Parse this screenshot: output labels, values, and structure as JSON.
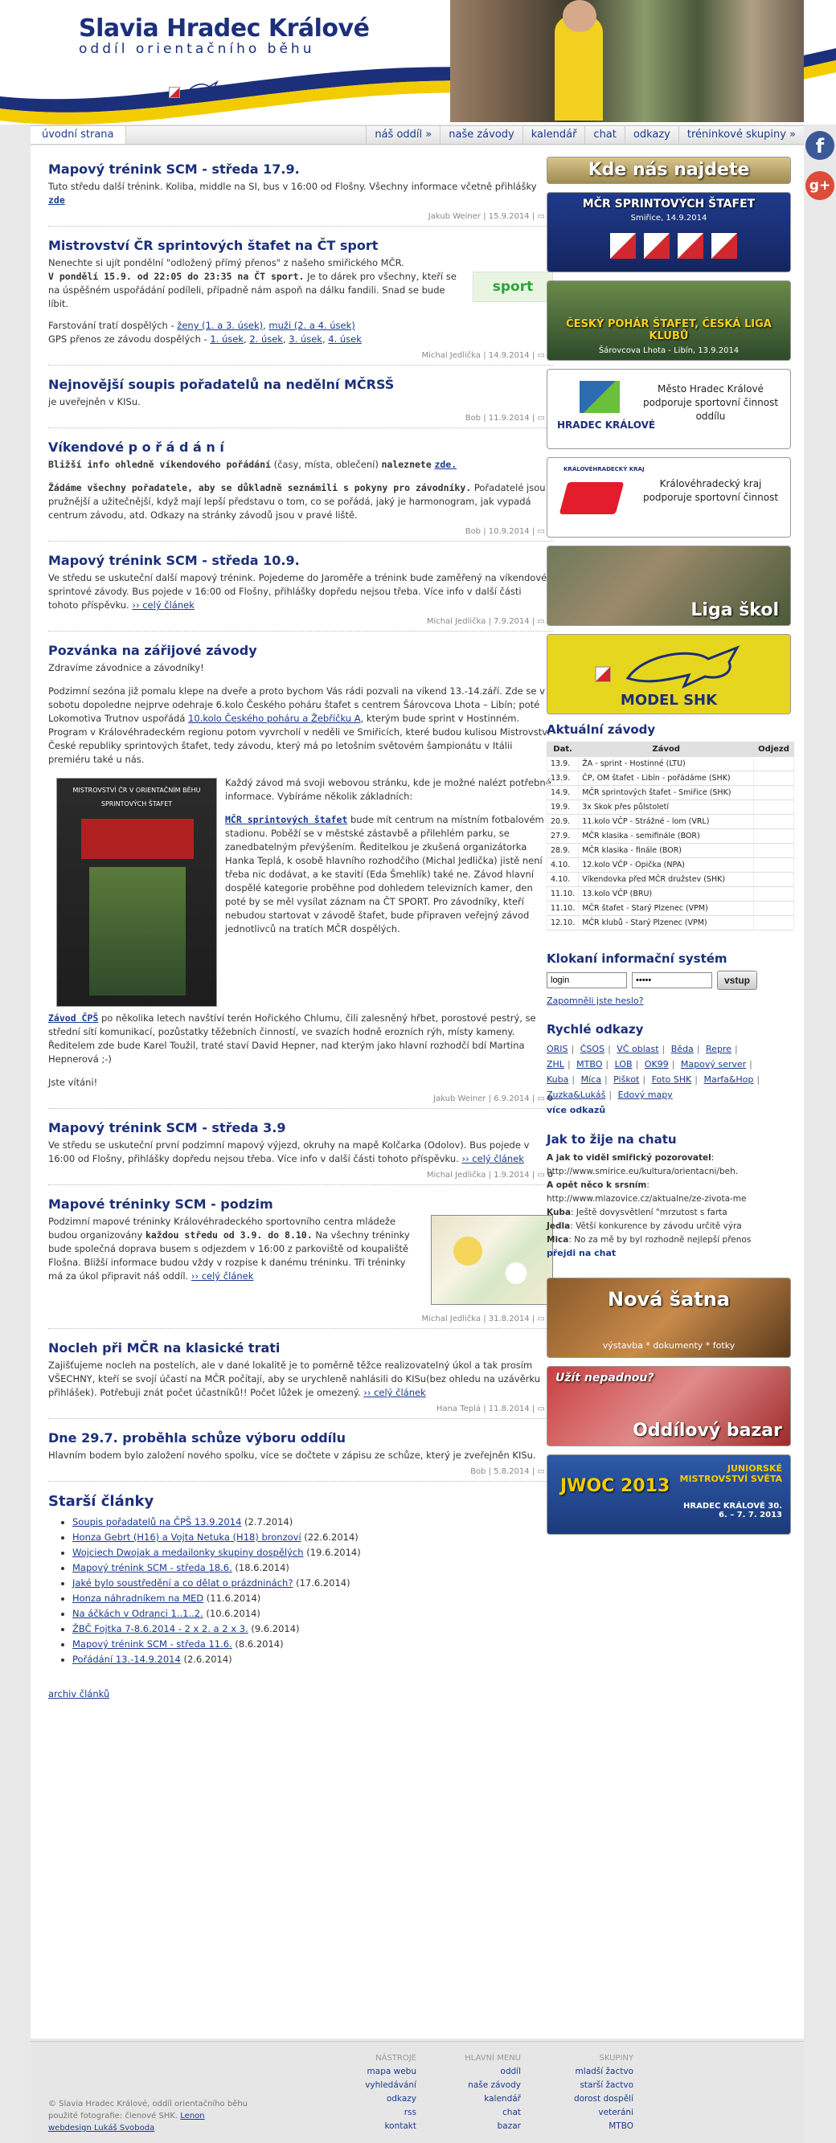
{
  "header": {
    "title": "Slavia Hradec Králové",
    "subtitle": "oddíl orientačního běhu"
  },
  "nav": {
    "home": "úvodní strana",
    "items": [
      "náš oddíl »",
      "naše závody",
      "kalendář",
      "chat",
      "odkazy",
      "tréninkové skupiny »"
    ]
  },
  "social": {
    "facebook": "f",
    "google": "g+"
  },
  "articles": [
    {
      "title": "Mapový trénink SCM - středa 17.9.",
      "body": "Tuto středu další trénink. Koliba, middle na SI, bus v 16:00 od Flošny. Všechny informace včetně přihlášky",
      "link": "zde",
      "author": "Jakub Weiner | 15.9.2014 |",
      "comments": "0"
    },
    {
      "title": "Mistrovství ČR sprintových štafet na ČT sport",
      "body1": "Nenechte si ujít pondělní \"odložený přímý přenos\" z našeho smiřického MČR.",
      "bold1": "V pondělí 15.9. od 22:05 do 23:35 na ČT sport.",
      "body2": "Je to dárek pro všechny, kteří se na úspěšném uspořádání podíleli, případně nám aspoň na dálku fandili. Snad se bude líbit.",
      "body3": "Farstování tratí dospělých -",
      "links3": [
        "ženy (1. a 3. úsek)",
        "muži (2. a 4. úsek)"
      ],
      "body4": "GPS přenos ze závodu dospělých -",
      "links4": [
        "1. úsek",
        "2. úsek",
        "3. úsek",
        "4. úsek"
      ],
      "logo": "sport",
      "author": "Michal Jedlička | 14.9.2014 |",
      "comments": "0"
    },
    {
      "title": "Nejnovější soupis pořadatelů na nedělní MČRSŠ",
      "body": "je uveřejněn v KISu.",
      "author": "Bob | 11.9.2014 |",
      "comments": "0"
    },
    {
      "title": "Víkendové p o ř á d á n í",
      "line1a": "Bližší info ohledně víkendového pořádání",
      "line1b": "(časy, místa, oblečení)",
      "line1c": "naleznete",
      "line1link": "zde.",
      "line2a": "Žádáme všechny pořadatele, aby se důkladně seznámili s pokyny pro závodníky.",
      "line2b": "Pořadatelé jsou pružnější a užitečnější, když mají lepší představu o tom, co se pořádá, jaký je harmonogram, jak vypadá centrum závodu, atd. Odkazy na stránky závodů jsou v pravé liště.",
      "author": "Bob | 10.9.2014 |",
      "comments": "4"
    },
    {
      "title": "Mapový trénink SCM - středa 10.9.",
      "body": "Ve středu se uskuteční další mapový trénink. Pojedeme do Jaroměře a trénink bude zaměřený na víkendové sprintové závody. Bus pojede v 16:00 od Flošny, přihlášky dopředu nejsou třeba. Více info v další části tohoto příspěvku.",
      "link": "›› celý článek",
      "author": "Michal Jedlička | 7.9.2014 |",
      "comments": "0"
    },
    {
      "title": "Pozvánka na zářijové závody",
      "p1": "Zdravíme závodnice a závodníky!",
      "p2": "Podzimní sezóna již pomalu klepe na dveře a proto bychom Vás rádi pozvali na víkend 13.-14.září. Zde se v sobotu dopoledne nejprve odehraje 6.kolo Českého poháru štafet s centrem Šárovcova Lhota – Libín; poté Lokomotiva Trutnov uspořádá",
      "p2link": "10.kolo Českého poháru a Žebříčku A",
      "p2b": ", kterým bude sprint v Hostinném. Program v Královéhradeckém regionu potom vyvrcholí v neděli ve Smiřicích, které budou kulisou Mistrovství České republiky sprintových štafet, tedy závodu, který má po letošním světovém šampionátu v Itálii premiéru také u nás.",
      "p3": "Každý závod má svoji webovou stránku, kde je možné nalézt potřebné informace. Vybíráme několik základních:",
      "p4link": "MČR sprintových štafet",
      "p4": "bude mít centrum na místním fotbalovém stadionu. Poběží se v městské zástavbě a přilehlém parku, se zanedbatelným převýšením. Ředitelkou je zkušená organizátorka Hanka Teplá, k osobě hlavního rozhodčího (Michal Jedlička) jistě není třeba nic dodávat, a ke stavití (Eda Šmehlík) také ne. Závod hlavní dospělé kategorie proběhne pod dohledem televizních kamer, den poté by se měl vysílat záznam na ČT SPORT. Pro závodníky, kteří nebudou startovat v závodě štafet, bude připraven veřejný závod jednotlivců na tratích MČR dospělých.",
      "p5link": "Závod ČPŠ",
      "p5": "po několika letech navštíví terén Hořického Chlumu, čili zalesněný hřbet, porostové pestrý, se střední sítí komunikací, pozůstatky těžebních činností, ve svazích hodně erozních rýh, místy kameny. Ředitelem zde bude Karel Toužil, traté staví David Hepner, nad kterým jako hlavní rozhodčí bdí Martina Hepnerová ;-)",
      "p6": "Jste vítáni!",
      "poster": "MISTROVSTVÍ ČR V ORIENTAČNÍM BĚHU SPRINTOVÝCH ŠTAFET",
      "author": "Jakub Weiner | 6.9.2014 |",
      "comments": "0"
    },
    {
      "title": "Mapový trénink SCM - středa 3.9",
      "body": "Ve středu se uskuteční první podzimní mapový výjezd, okruhy na mapě Kolčarka (Odolov). Bus pojede v 16:00 od Flošny, přihlášky dopředu nejsou třeba. Více info v další části tohoto příspěvku.",
      "link": "›› celý článek",
      "author": "Michal Jedlička | 1.9.2014 |",
      "comments": "0"
    },
    {
      "title": "Mapové tréninky SCM - podzim",
      "body1": "Podzimní mapové tréninky Královéhradeckého sportovního centra mládeže budou organizovány",
      "bold": "každou středu od 3.9. do 8.10.",
      "body2": "Na všechny tréninky bude společná doprava busem s odjezdem v 16:00 z parkoviště od koupaliště Flošna. Bližší informace budou vždy v rozpise k danému tréninku. Tři tréninky má za úkol připravit náš oddíl.",
      "link": "›› celý článek",
      "author": "Michal Jedlička | 31.8.2014 |",
      "comments": "0"
    },
    {
      "title": "Nocleh při MČR na klasické trati",
      "body": "Zajišťujeme nocleh na postelích, ale v dané lokalitě je to poměrně těžce realizovatelný úkol a tak prosím VŠECHNY, kteří se svojí účastí na MČR počítají, aby se urychleně nahlásili do KISu(bez ohledu na uzávěrku přihlášek). Potřebuji znát počet účastníků!! Počet lůžek je omezený.",
      "link": "›› celý článek",
      "author": "Hana Teplá | 11.8.2014 |",
      "comments": "1"
    },
    {
      "title": "Dne 29.7. proběhla schůze výboru oddílu",
      "body": "Hlavním bodem bylo založení nového spolku, více se dočtete v zápisu ze schůze, který je zveřejněn KISu.",
      "author": "Bob | 5.8.2014 |",
      "comments": "0"
    }
  ],
  "older": {
    "title": "Starší články",
    "items": [
      {
        "link": "Soupis pořadatelů na ČPŠ 13.9.2014",
        "date": "(2.7.2014)"
      },
      {
        "link": "Honza Gebrt (H16) a Vojta Netuka (H18) bronzoví",
        "date": "(22.6.2014)"
      },
      {
        "link": "Wojciech Dwojak a medailonky skupiny dospělých",
        "date": "(19.6.2014)"
      },
      {
        "link": "Mapový trénink SCM - středa 18.6.",
        "date": "(18.6.2014)"
      },
      {
        "link": "Jaké bylo soustředění a co dělat o prázdninách?",
        "date": "(17.6.2014)"
      },
      {
        "link": "Honza náhradníkem na MED",
        "date": "(11.6.2014)"
      },
      {
        "link": "Na áčkách v Odranci 1..1..2.",
        "date": "(10.6.2014)"
      },
      {
        "link": "ŽBČ Fojtka 7-8.6.2014 - 2 x 2. a 2 x 3.",
        "date": "(9.6.2014)"
      },
      {
        "link": "Mapový trénink SCM - středa 11.6.",
        "date": "(8.6.2014)"
      },
      {
        "link": "Pořádání 13.-14.9.2014",
        "date": "(2.6.2014)"
      }
    ],
    "archive": "archiv článků"
  },
  "sidebar": {
    "banners": {
      "kde": "Kde nás najdete",
      "mcr": "MČR SPRINTOVÝCH ŠTAFET",
      "mcr_sub": "Smiřice, 14.9.2014",
      "cp": "ČESKÝ POHÁR ŠTAFET, ČESKÁ LIGA KLUBŮ",
      "cp_sub": "Šárovcova Lhota - Libín, 13.9.2014",
      "hk_name": "HRADEC KRÁLOVÉ",
      "hk_text": "Město Hradec Králové podporuje sportovní činnost oddílu",
      "kraj_text": "Královéhradecký kraj podporuje sportovní činnost",
      "kraj_logo": "KRÁLOVÉHRADECKÝ KRAJ",
      "liga": "Liga škol",
      "model": "MODEL SHK"
    },
    "races": {
      "title": "Aktuální závody",
      "headers": [
        "Dat.",
        "Závod",
        "Odjezd"
      ],
      "rows": [
        [
          "13.9.",
          "ŽA - sprint - Hostinné (LTU)"
        ],
        [
          "13.9.",
          "ČP, OM štafet - Libín - pořádáme (SHK)"
        ],
        [
          "14.9.",
          "MČR sprintových štafet - Smiřice (SHK)"
        ],
        [
          "19.9.",
          "3x Skok přes půlstoletí"
        ],
        [
          "20.9.",
          "11.kolo VČP - Strážné - lom (VRL)"
        ],
        [
          "27.9.",
          "MČR klasika - semifinále (BOR)"
        ],
        [
          "28.9.",
          "MČR klasika - finále (BOR)"
        ],
        [
          "4.10.",
          "12.kolo VČP - Opička (NPA)"
        ],
        [
          "4.10.",
          "Víkendovka před MČR družstev (SHK)"
        ],
        [
          "11.10.",
          "13.kolo VČP (BRU)"
        ],
        [
          "11.10.",
          "MČR štafet - Starý Plzenec (VPM)"
        ],
        [
          "12.10.",
          "MČR klubů - Starý Plzenec (VPM)"
        ]
      ]
    },
    "login": {
      "title": "Klokaní informační systém",
      "login_value": "login",
      "password_value": "•••••",
      "button": "vstup",
      "forgot": "Zapomněli jste heslo?"
    },
    "quick": {
      "title": "Rychlé odkazy",
      "links": [
        "ORIS",
        "ČSOS",
        "VČ oblast",
        "Běda",
        "Repre",
        "ZHL",
        "MTBO",
        "LOB",
        "OK99",
        "Mapový server",
        "Kuba",
        "Míca",
        "Piškot",
        "Foto SHK",
        "Marfa&Hop",
        "Zuzka&Lukáš",
        "Edový mapy"
      ],
      "more": "více odkazů"
    },
    "chat": {
      "title": "Jak to žije na chatu",
      "lines": [
        {
          "who": "A jak to viděl smiřický pozorovatel",
          "text": ": http://www.smirice.eu/kultura/orientacni/beh."
        },
        {
          "who": "A opět něco k srsním",
          "text": ": http://www.mlazovice.cz/aktualne/ze-zivota-me"
        },
        {
          "who": "Kuba",
          "text": ": Ještě dovysvětlení \"mrzutost s farta"
        },
        {
          "who": "Jedla",
          "text": ": Větší konkurence by závodu určitě výra"
        },
        {
          "who": "Mica",
          "text": ": No za mě by byl rozhodně nejlepší přenos"
        }
      ],
      "link": "přejdi na chat"
    },
    "promo": {
      "satna": "Nová šatna",
      "satna_sub": "výstavba * dokumenty * fotky",
      "bazar_q": "Užít nepadnou?",
      "bazar": "Oddílový bazar",
      "jwoc": "JWOC 2013",
      "jwoc_sub": "JUNIORSKÉ MISTROVSTVÍ SVĚTA",
      "jwoc_place": "HRADEC KRÁLOVÉ 30. 6. – 7. 7. 2013"
    }
  },
  "footer": {
    "copyright": "© Slavia Hradec Králové, oddíl orientačního běhu",
    "photos": "použité fotografie: členové SHK.",
    "photos_link": "Lenon",
    "webdesign": "webdesign Lukáš Svoboda",
    "cols": [
      {
        "title": "NÁSTROJE",
        "links": [
          "mapa webu",
          "vyhledávání",
          "odkazy",
          "rss",
          "kontakt"
        ]
      },
      {
        "title": "HLAVNÍ MENU",
        "links": [
          "oddíl",
          "naše závody",
          "kalendář",
          "chat",
          "bazar"
        ]
      },
      {
        "title": "SKUPINY",
        "links": [
          "mladší žactvo",
          "starší žactvo",
          "dorost",
          "dospělí",
          "veteráni",
          "MTBO"
        ]
      }
    ]
  }
}
